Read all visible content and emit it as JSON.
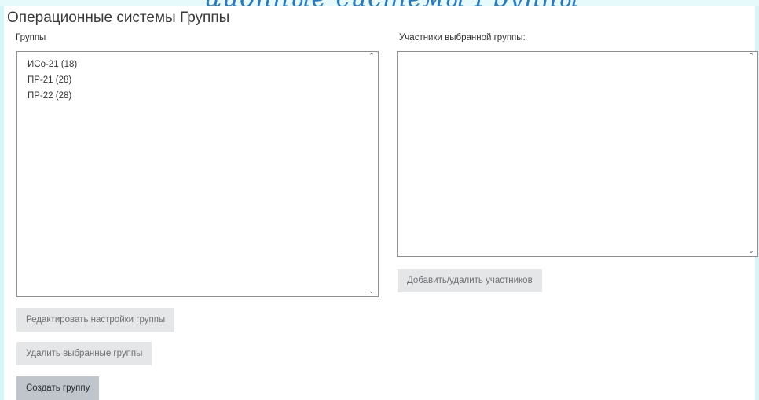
{
  "header": {
    "banner_fragment": "ционные системы Группы",
    "title": "Операционные системы Группы"
  },
  "groups": {
    "label": "Группы",
    "items": [
      "ИСо-21 (18)",
      "ПР-21 (28)",
      "ПР-22 (28)"
    ]
  },
  "members": {
    "label": "Участники выбранной группы:",
    "items": []
  },
  "buttons": {
    "add_remove_members": "Добавить/удалить участников",
    "edit_group_settings": "Редактировать настройки группы",
    "delete_selected_groups": "Удалить выбранные группы",
    "create_group": "Создать группу"
  },
  "icons": {
    "scroll_up": "chevron-up-icon",
    "scroll_down": "chevron-down-icon"
  },
  "colors": {
    "frame": "#d8f6f8",
    "banner_text": "#2e79b7",
    "button_disabled_bg": "#e4e6e8",
    "button_primary_bg": "#bfc5cb"
  }
}
